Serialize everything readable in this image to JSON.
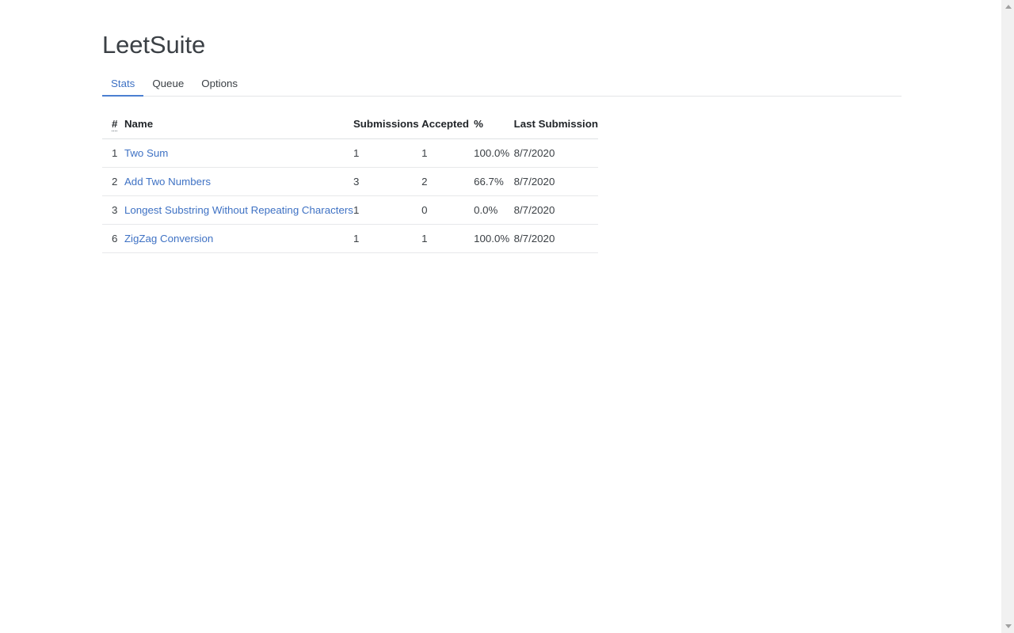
{
  "app": {
    "title": "LeetSuite"
  },
  "tabs": [
    {
      "label": "Stats",
      "active": true,
      "name": "tab-stats"
    },
    {
      "label": "Queue",
      "active": false,
      "name": "tab-queue"
    },
    {
      "label": "Options",
      "active": false,
      "name": "tab-options"
    }
  ],
  "table": {
    "columns": [
      {
        "key": "rank",
        "label": "#"
      },
      {
        "key": "name",
        "label": "Name"
      },
      {
        "key": "submissions",
        "label": "Submissions"
      },
      {
        "key": "accepted",
        "label": "Accepted"
      },
      {
        "key": "percent",
        "label": "%"
      },
      {
        "key": "last_submission",
        "label": "Last Submission"
      }
    ],
    "rows": [
      {
        "rank": "1",
        "name": "Two Sum",
        "submissions": "1",
        "accepted": "1",
        "percent": "100.0%",
        "last_submission": "8/7/2020"
      },
      {
        "rank": "2",
        "name": "Add Two Numbers",
        "submissions": "3",
        "accepted": "2",
        "percent": "66.7%",
        "last_submission": "8/7/2020"
      },
      {
        "rank": "3",
        "name": "Longest Substring Without Repeating Characters",
        "submissions": "1",
        "accepted": "0",
        "percent": "0.0%",
        "last_submission": "8/7/2020"
      },
      {
        "rank": "6",
        "name": "ZigZag Conversion",
        "submissions": "1",
        "accepted": "1",
        "percent": "100.0%",
        "last_submission": "8/7/2020"
      }
    ]
  },
  "scrollbar": {
    "up_icon": "scroll-up-arrow-icon",
    "down_icon": "scroll-down-arrow-icon"
  },
  "colors": {
    "accent": "#3f72c4",
    "tab_underline": "#4b7fd1",
    "text": "#3b4045",
    "header_text": "#212529",
    "border": "#dfe1e3",
    "background": "#ffffff"
  }
}
